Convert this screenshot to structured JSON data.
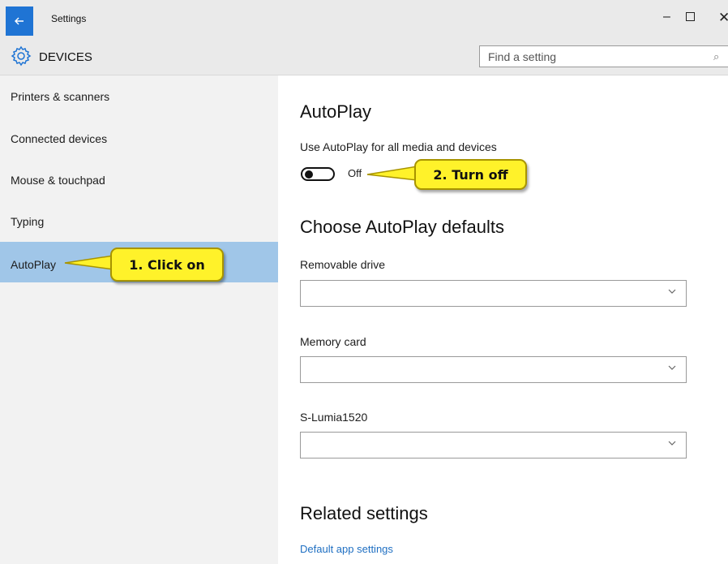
{
  "window": {
    "title": "Settings",
    "back_icon": "back-arrow-icon",
    "minimize_glyph": "–",
    "close_glyph": "✕"
  },
  "header": {
    "section_title": "DEVICES",
    "section_icon": "gear-icon",
    "search_placeholder": "Find a setting",
    "search_icon": "search-icon"
  },
  "sidebar": {
    "items": [
      {
        "label": "Printers & scanners",
        "selected": false
      },
      {
        "label": "Connected devices",
        "selected": false
      },
      {
        "label": "Mouse & touchpad",
        "selected": false
      },
      {
        "label": "Typing",
        "selected": false
      },
      {
        "label": "AutoPlay",
        "selected": true
      }
    ],
    "selected_color": "#a0c6e8"
  },
  "main": {
    "autoplay_heading": "AutoPlay",
    "autoplay_toggle_label": "Use AutoPlay for all media and devices",
    "autoplay_toggle_state": "Off",
    "autoplay_toggle_on": false,
    "defaults_heading": "Choose AutoPlay defaults",
    "dropdowns": [
      {
        "label": "Removable drive",
        "value": ""
      },
      {
        "label": "Memory card",
        "value": ""
      },
      {
        "label": "S-Lumia1520",
        "value": ""
      }
    ],
    "related_heading": "Related settings",
    "related_link": "Default app settings"
  },
  "callouts": {
    "step1": "1. Click on",
    "step2": "2. Turn off",
    "color": "#fff22a"
  },
  "colors": {
    "accent": "#1f74d4",
    "link": "#1f6fc2"
  }
}
